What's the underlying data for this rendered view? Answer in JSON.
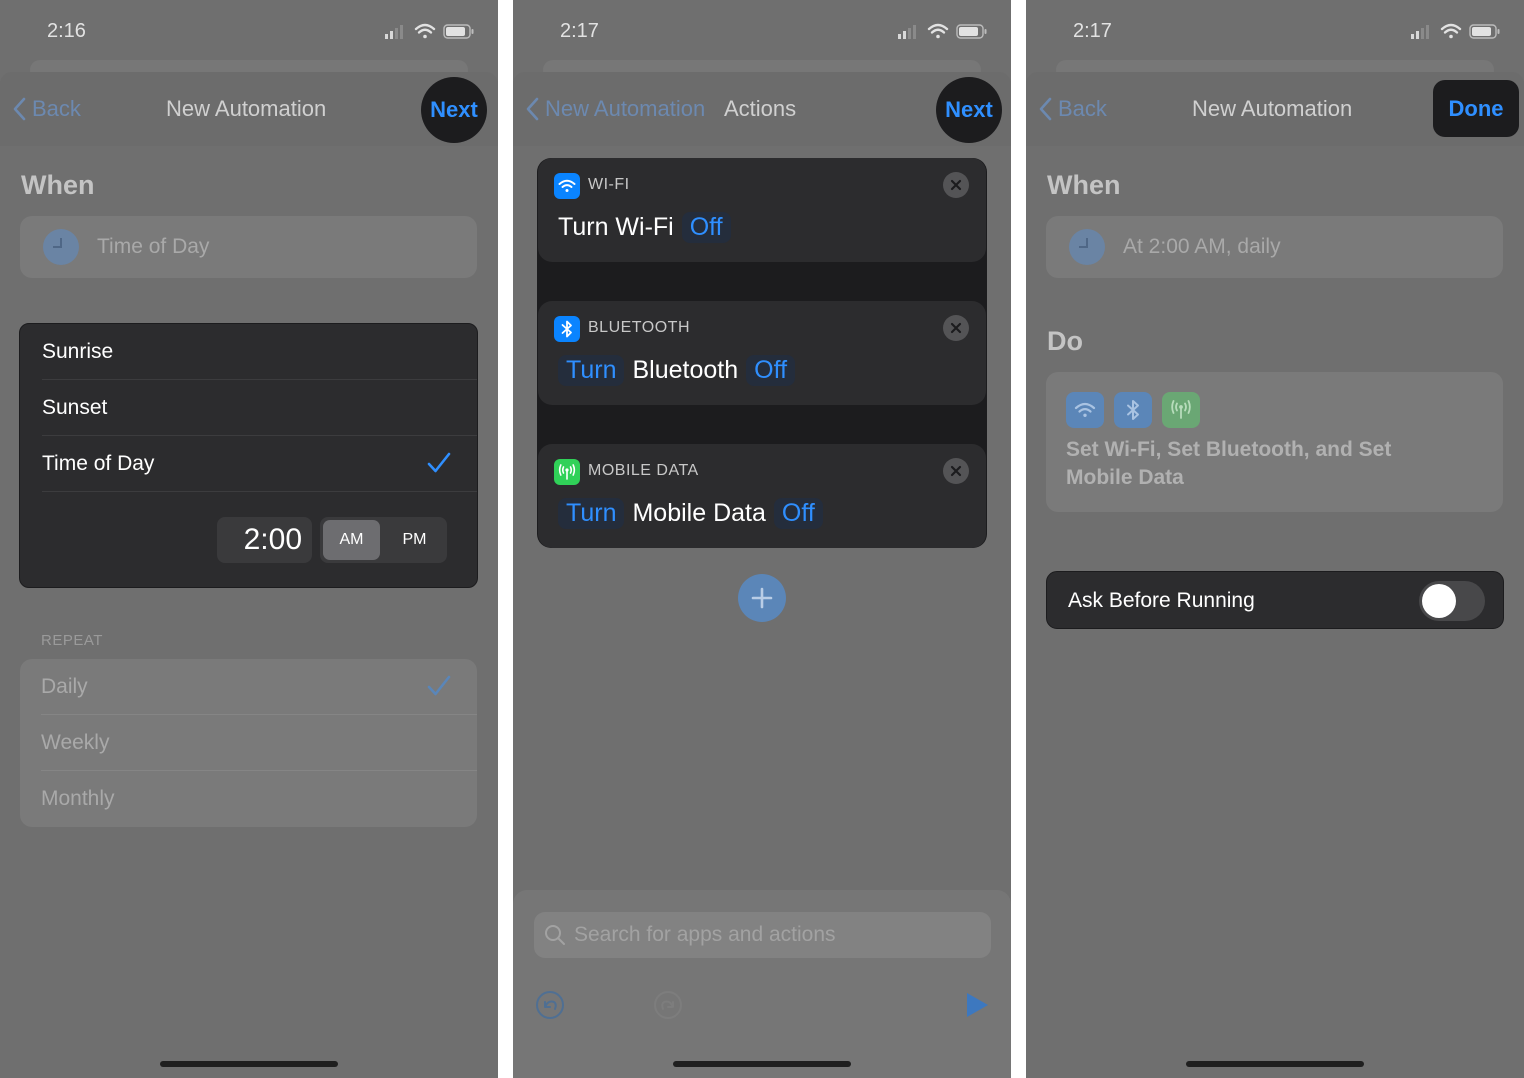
{
  "screen1": {
    "status_time": "2:16",
    "nav": {
      "back": "Back",
      "title": "New Automation",
      "next": "Next"
    },
    "when_heading": "When",
    "when_value": "Time of Day",
    "picker": {
      "options": [
        "Sunrise",
        "Sunset",
        "Time of Day"
      ],
      "selected": "Time of Day",
      "time": "2:00",
      "am": "AM",
      "pm": "PM",
      "selected_period": "AM"
    },
    "repeat": {
      "label": "REPEAT",
      "options": [
        "Daily",
        "Weekly",
        "Monthly"
      ],
      "selected": "Daily"
    }
  },
  "screen2": {
    "status_time": "2:17",
    "nav": {
      "back": "New Automation",
      "title": "Actions",
      "next": "Next"
    },
    "actions": [
      {
        "label": "WI-FI",
        "text": "Turn Wi-Fi",
        "state": "Off",
        "icon": "wifi-icon",
        "color": "#0a84ff"
      },
      {
        "label": "BLUETOOTH",
        "verb": "Turn",
        "text": "Bluetooth",
        "state": "Off",
        "icon": "bluetooth-icon",
        "color": "#0a84ff"
      },
      {
        "label": "MOBILE DATA",
        "verb": "Turn",
        "text": "Mobile Data",
        "state": "Off",
        "icon": "antenna-icon",
        "color": "#30d158"
      }
    ],
    "search_placeholder": "Search for apps and actions"
  },
  "screen3": {
    "status_time": "2:17",
    "nav": {
      "back": "Back",
      "title": "New Automation",
      "done": "Done"
    },
    "when_heading": "When",
    "when_value": "At 2:00 AM, daily",
    "do_heading": "Do",
    "do_summary": "Set Wi-Fi, Set Bluetooth, and Set Mobile Data",
    "ask_before_running": "Ask Before Running",
    "ask_before_running_on": false
  },
  "colors": {
    "accent": "#2f8fff",
    "dark_card": "#2c2c2e",
    "dim_overlay": "#6f6f6f"
  }
}
